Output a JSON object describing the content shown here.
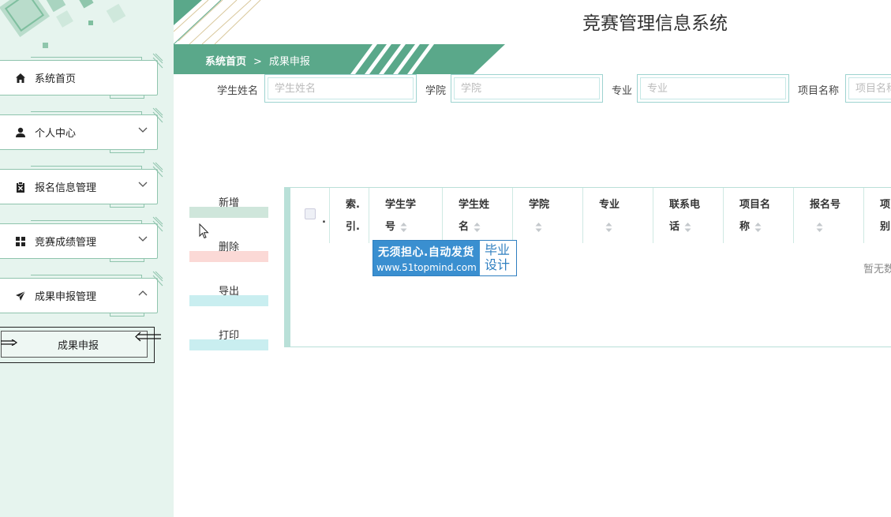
{
  "app": {
    "title": "竞赛管理信息系统"
  },
  "breadcrumb": {
    "home": "系统首页",
    "separator": ">",
    "current": "成果申报"
  },
  "sidebar": {
    "items": [
      {
        "label": "系统首页",
        "icon": "home-icon",
        "has_submenu": false
      },
      {
        "label": "个人中心",
        "icon": "user-icon",
        "has_submenu": true,
        "expanded": false
      },
      {
        "label": "报名信息管理",
        "icon": "clipboard-icon",
        "has_submenu": true,
        "expanded": false
      },
      {
        "label": "竞赛成绩管理",
        "icon": "grid-icon",
        "has_submenu": true,
        "expanded": false
      },
      {
        "label": "成果申报管理",
        "icon": "send-icon",
        "has_submenu": true,
        "expanded": true
      }
    ],
    "subitems": [
      {
        "label": "成果申报"
      }
    ]
  },
  "search": {
    "student_name": {
      "label": "学生姓名",
      "placeholder": "学生姓名",
      "value": ""
    },
    "college": {
      "label": "学院",
      "placeholder": "学院",
      "value": ""
    },
    "major": {
      "label": "专业",
      "placeholder": "专业",
      "value": ""
    },
    "project_name": {
      "label": "项目名称",
      "placeholder": "项目名称",
      "value": ""
    }
  },
  "actions": {
    "add": "新增",
    "delete": "删除",
    "export": "导出",
    "print": "打印"
  },
  "table": {
    "columns": [
      {
        "line1": "索.",
        "line2": "引."
      },
      {
        "line1": "学生学",
        "line2": "号"
      },
      {
        "line1": "学生姓",
        "line2": "名"
      },
      {
        "line1": "学院",
        "line2": ""
      },
      {
        "line1": "专业",
        "line2": ""
      },
      {
        "line1": "联系电",
        "line2": "话"
      },
      {
        "line1": "项目名",
        "line2": "称"
      },
      {
        "line1": "报名号",
        "line2": ""
      },
      {
        "line1": "项",
        "line2": "别"
      }
    ],
    "checkbox_suffix": ".",
    "rows": [],
    "empty_text": "暂无数"
  },
  "watermark": {
    "line1": "无须担心.自动发货",
    "line2": "www.51topmind.com",
    "badge_line1": "毕业",
    "badge_line2": "设计"
  },
  "colors": {
    "primary": "#5aa88a",
    "sidebar_bg": "#e6f4ee",
    "add_bar": "#cfe6db",
    "delete_bar": "#fbd9d6",
    "export_bar": "#c9eef0",
    "print_bar": "#c9eef0",
    "table_border": "#b9e0d8"
  }
}
